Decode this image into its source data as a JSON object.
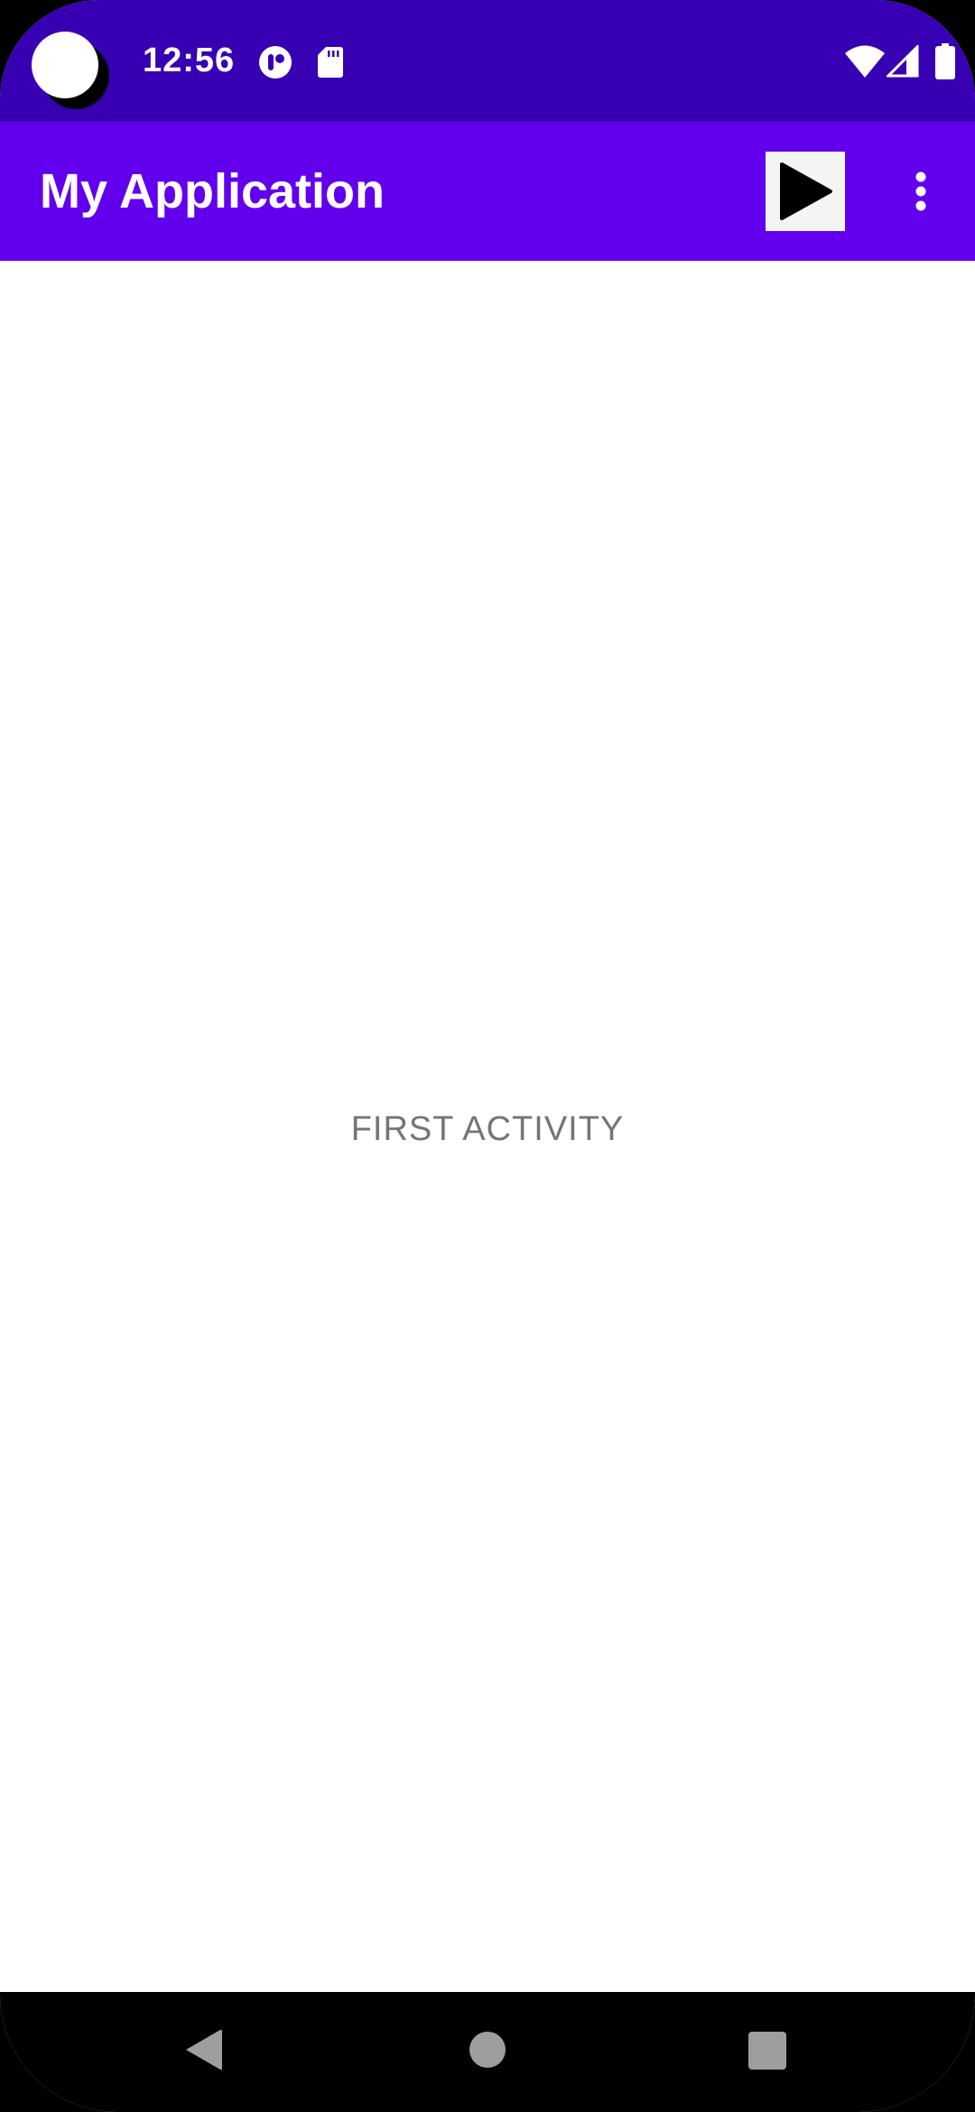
{
  "status_bar": {
    "time": "12:56",
    "icons": [
      "camera-cutout-icon",
      "notification-app-icon",
      "sd-card-icon",
      "wifi-icon",
      "cellular-signal-icon",
      "battery-icon"
    ],
    "background_color": "#3700b3"
  },
  "app_bar": {
    "title": "My Application",
    "background_color": "#6200ee",
    "actions": [
      "play-icon",
      "more-vert-icon"
    ]
  },
  "main": {
    "label": "FIRST ACTIVITY",
    "label_color": "#757575"
  },
  "nav_bar": {
    "buttons": [
      "back-icon",
      "home-icon",
      "recents-icon"
    ],
    "button_color": "#9e9e9e"
  }
}
